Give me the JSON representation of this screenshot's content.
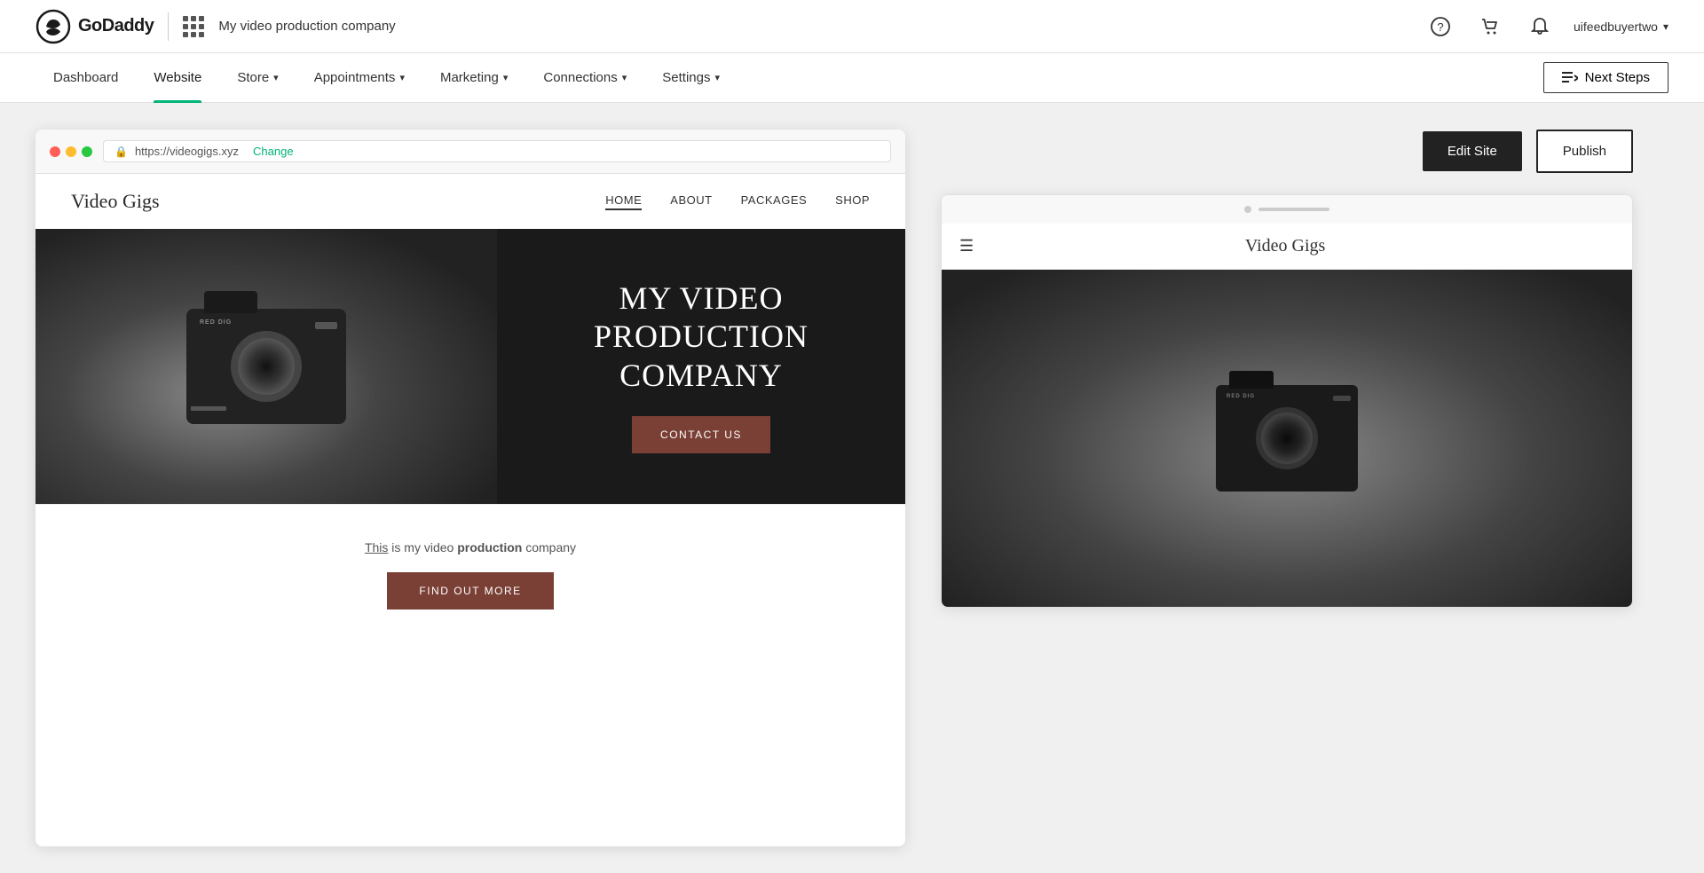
{
  "topbar": {
    "logo_text": "GoDaddy",
    "company_name": "My video production company",
    "help_icon": "?",
    "cart_icon": "🛒",
    "notification_icon": "🔔",
    "username": "uifeedbuyertwo",
    "chevron": "▾"
  },
  "navbar": {
    "items": [
      {
        "id": "dashboard",
        "label": "Dashboard",
        "active": false,
        "has_chevron": false
      },
      {
        "id": "website",
        "label": "Website",
        "active": true,
        "has_chevron": false
      },
      {
        "id": "store",
        "label": "Store",
        "active": false,
        "has_chevron": true
      },
      {
        "id": "appointments",
        "label": "Appointments",
        "active": false,
        "has_chevron": true
      },
      {
        "id": "marketing",
        "label": "Marketing",
        "active": false,
        "has_chevron": true
      },
      {
        "id": "connections",
        "label": "Connections",
        "active": false,
        "has_chevron": true
      },
      {
        "id": "settings",
        "label": "Settings",
        "active": false,
        "has_chevron": true
      }
    ],
    "next_steps_label": "Next Steps"
  },
  "browser": {
    "url": "https://videogigs.xyz",
    "change_label": "Change"
  },
  "website": {
    "site_title": "Video Gigs",
    "nav_items": [
      {
        "label": "HOME",
        "active": true
      },
      {
        "label": "ABOUT",
        "active": false
      },
      {
        "label": "PACKAGES",
        "active": false
      },
      {
        "label": "SHOP",
        "active": false
      }
    ],
    "hero_title": "MY VIDEO PRODUCTION COMPANY",
    "hero_cta": "CONTACT US",
    "tagline_prefix": "is my video ",
    "tagline_bold": "production",
    "tagline_suffix": " company",
    "tagline_link": "This",
    "find_more_btn": "FIND OUT MORE"
  },
  "actions": {
    "edit_site": "Edit Site",
    "publish": "Publish"
  },
  "mobile": {
    "site_title": "Video Gigs"
  }
}
